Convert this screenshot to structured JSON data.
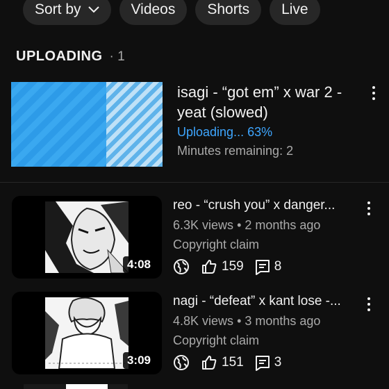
{
  "filters": {
    "sort_label": "Sort by",
    "chips": [
      "Videos",
      "Shorts",
      "Live"
    ]
  },
  "uploading": {
    "heading": "UPLOADING",
    "separator": "·",
    "count": "1",
    "title": "isagi - “got em” x war 2 - yeat (slowed)",
    "status": "Uploading... 63%",
    "progress": 0.63,
    "remaining": "Minutes remaining: 2"
  },
  "videos": [
    {
      "title": "reo - “crush you” x danger...",
      "views": "6.3K views",
      "age": "2 months ago",
      "claim": "Copyright claim",
      "likes": "159",
      "comments": "8",
      "duration": "4:08"
    },
    {
      "title": "nagi - “defeat” x kant lose -...",
      "views": "4.8K views",
      "age": "3 months ago",
      "claim": "Copyright claim",
      "likes": "151",
      "comments": "3",
      "duration": "3:09"
    }
  ],
  "colors": {
    "background": "#0f0f0f",
    "chip": "#272727",
    "accent": "#3ea6ff",
    "secondary_text": "#aaaaaa"
  }
}
